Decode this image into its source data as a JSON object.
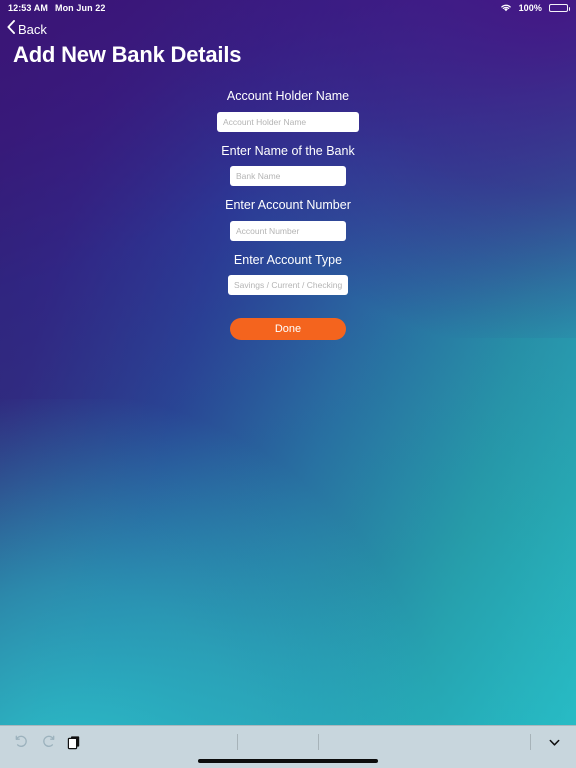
{
  "status_bar": {
    "time": "12:53 AM",
    "date": "Mon Jun 22",
    "wifi_icon": "wifi-icon",
    "battery_percent": "100%",
    "battery_icon": "battery-full-icon"
  },
  "nav": {
    "back_icon": "chevron-left-icon",
    "back_label": "Back"
  },
  "header": {
    "title": "Add New Bank Details"
  },
  "form": {
    "fields": [
      {
        "label": "Account Holder Name",
        "placeholder": "Account Holder Name",
        "value": ""
      },
      {
        "label": "Enter Name of the Bank",
        "placeholder": "Bank Name",
        "value": ""
      },
      {
        "label": "Enter Account Number",
        "placeholder": "Account Number",
        "value": ""
      },
      {
        "label": "Enter Account Type",
        "placeholder": "Savings / Current / Checking",
        "value": ""
      }
    ],
    "submit_label": "Done"
  },
  "toolbar": {
    "undo_icon": "undo-icon",
    "redo_icon": "redo-icon",
    "paste_icon": "paste-icon",
    "dismiss_icon": "chevron-down-icon"
  },
  "colors": {
    "accent_button": "#f4641e",
    "gradient_top_left": "#2f1761",
    "gradient_bottom_left": "#2ebfc8",
    "gradient_right_mid": "#2d3f92",
    "toolbar_background": "#c8d6dd",
    "text_primary": "#ffffff",
    "placeholder": "#b4b4b4"
  }
}
